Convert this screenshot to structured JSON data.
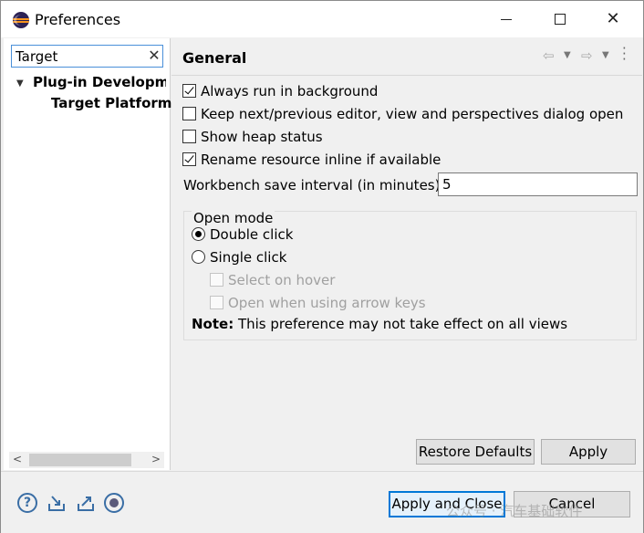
{
  "window": {
    "title": "Preferences"
  },
  "title_controls": {
    "minimize": "minimize",
    "maximize": "maximize",
    "close": "✕"
  },
  "filter": {
    "value": "Target",
    "clear": "✕"
  },
  "tree": {
    "items": [
      {
        "label": "Plug-in Development",
        "expanded": true
      },
      {
        "label": "Target Platform"
      }
    ]
  },
  "page": {
    "title": "General",
    "options": [
      {
        "label": "Always run in background",
        "checked": true
      },
      {
        "label": "Keep next/previous editor, view and perspectives dialog open",
        "checked": false
      },
      {
        "label": "Show heap status",
        "checked": false
      },
      {
        "label": "Rename resource inline if available",
        "checked": true
      }
    ],
    "save_interval": {
      "label": "Workbench save interval (in minutes):",
      "value": "5"
    },
    "open_mode": {
      "title": "Open mode",
      "double_click": "Double click",
      "single_click": "Single click",
      "select_on_hover": "Select on hover",
      "open_arrow_keys": "Open when using arrow keys",
      "note_label": "Note:",
      "note_text": " This preference may not take effect on all views"
    },
    "restore_defaults": "Restore Defaults",
    "apply": "Apply"
  },
  "footer": {
    "apply_and_close": "Apply and Close",
    "cancel": "Cancel"
  },
  "watermark": "公众号 · 汽车基础软件"
}
